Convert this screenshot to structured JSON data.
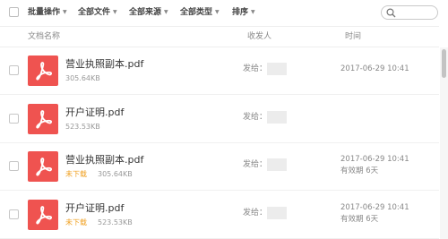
{
  "toolbar": {
    "batch_label": "批量操作",
    "files_label": "全部文件",
    "source_label": "全部来源",
    "type_label": "全部类型",
    "sort_label": "排序"
  },
  "header": {
    "name_col": "文档名称",
    "sender_col": "收发人",
    "time_col": "时间"
  },
  "rows": [
    {
      "name": "营业执照副本.pdf",
      "status": "",
      "size": "305.64KB",
      "sender_prefix": "发给：",
      "time": "2017-06-29 10:41",
      "expiry": ""
    },
    {
      "name": "开户证明.pdf",
      "status": "",
      "size": "523.53KB",
      "sender_prefix": "发给：",
      "time": "",
      "expiry": ""
    },
    {
      "name": "营业执照副本.pdf",
      "status": "未下载",
      "size": "305.64KB",
      "sender_prefix": "发给：",
      "time": "2017-06-29 10:41",
      "expiry": "有效期 6天"
    },
    {
      "name": "开户证明.pdf",
      "status": "未下载",
      "size": "523.53KB",
      "sender_prefix": "发给：",
      "time": "2017-06-29 10:41",
      "expiry": "有效期 6天"
    }
  ],
  "icons": {
    "file_icon": "pdf-file-icon",
    "search_icon": "search-icon",
    "caret_icon": "caret-down-icon"
  },
  "colors": {
    "pdf_red": "#ef5350",
    "status_orange": "#f0a020"
  }
}
